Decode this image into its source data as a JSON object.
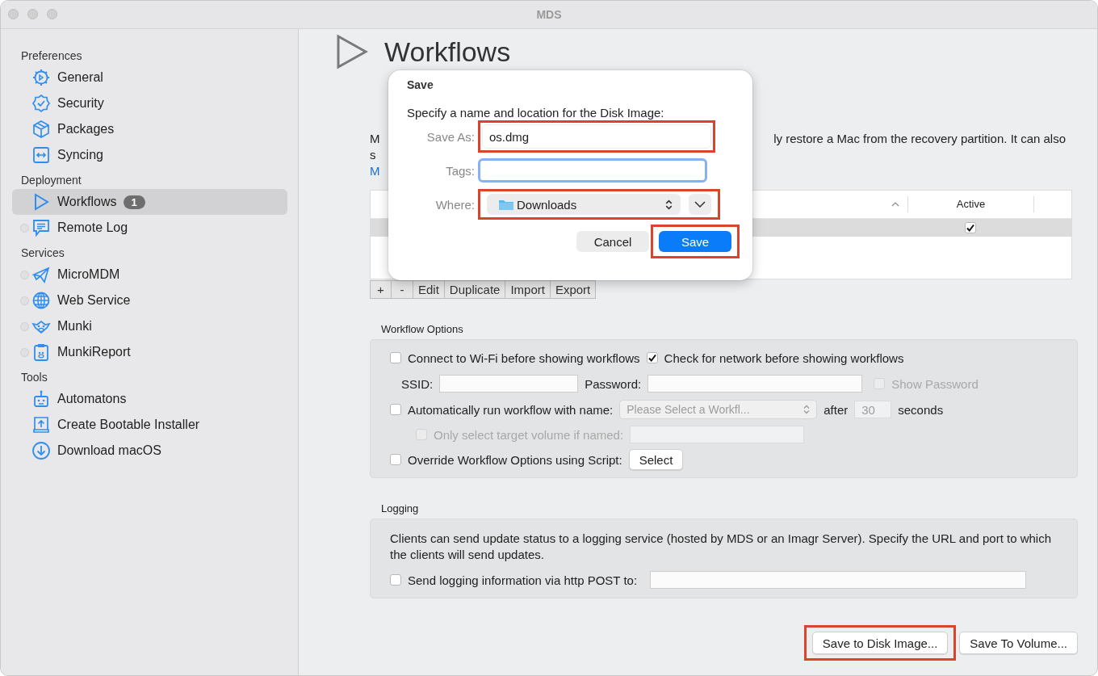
{
  "window": {
    "title": "MDS"
  },
  "sidebar": {
    "sections": [
      {
        "title": "Preferences",
        "items": [
          {
            "label": "General",
            "selected": false,
            "indicator": false
          },
          {
            "label": "Security",
            "selected": false,
            "indicator": false
          },
          {
            "label": "Packages",
            "selected": false,
            "indicator": false
          },
          {
            "label": "Syncing",
            "selected": false,
            "indicator": false
          }
        ]
      },
      {
        "title": "Deployment",
        "items": [
          {
            "label": "Workflows",
            "selected": true,
            "indicator": false,
            "badge": "1"
          },
          {
            "label": "Remote Log",
            "selected": false,
            "indicator": true
          }
        ]
      },
      {
        "title": "Services",
        "items": [
          {
            "label": "MicroMDM",
            "selected": false,
            "indicator": true
          },
          {
            "label": "Web Service",
            "selected": false,
            "indicator": true
          },
          {
            "label": "Munki",
            "selected": false,
            "indicator": true
          },
          {
            "label": "MunkiReport",
            "selected": false,
            "indicator": true
          }
        ]
      },
      {
        "title": "Tools",
        "items": [
          {
            "label": "Automatons",
            "selected": false,
            "indicator": false
          },
          {
            "label": "Create Bootable Installer",
            "selected": false,
            "indicator": false
          },
          {
            "label": "Download macOS",
            "selected": false,
            "indicator": false
          }
        ]
      }
    ]
  },
  "page": {
    "title": "Workflows",
    "description_fragments": [
      "M",
      "ly restore a Mac from the recovery partition. It can also",
      "s"
    ],
    "link_fragment": "M"
  },
  "table": {
    "columns": [
      {
        "label": "Active"
      }
    ],
    "rows": [
      {
        "selected": true,
        "active": true
      }
    ]
  },
  "table_buttons": [
    "+",
    "-",
    "Edit",
    "Duplicate",
    "Import",
    "Export"
  ],
  "workflow_options": {
    "title": "Workflow Options",
    "connect_wifi": {
      "label": "Connect to Wi-Fi before showing workflows",
      "checked": false,
      "disabled": false
    },
    "check_network": {
      "label": "Check for network before showing workflows",
      "checked": true,
      "disabled": false
    },
    "ssid": {
      "label": "SSID:"
    },
    "password": {
      "label": "Password:"
    },
    "show_password": {
      "label": "Show Password",
      "checked": false,
      "disabled": true
    },
    "auto_run": {
      "label": "Automatically run workflow with name:",
      "checked": false,
      "disabled": false
    },
    "workflow_popup": {
      "value": "Please Select a Workfl...",
      "disabled": true
    },
    "after_label": "after",
    "delay": {
      "value": "30",
      "disabled": true
    },
    "seconds_label": "seconds",
    "target_volume": {
      "label": "Only select target volume if named:",
      "checked": false,
      "disabled": true
    },
    "target_volume_field": {
      "disabled": true
    },
    "override": {
      "label": "Override Workflow Options using Script:",
      "checked": false,
      "disabled": false
    },
    "select_button": "Select"
  },
  "logging": {
    "title": "Logging",
    "description": "Clients can send update status to a logging service (hosted by MDS or an Imagr Server). Specify the URL and port to which the clients will send updates.",
    "send": {
      "label": "Send logging information via http POST to:",
      "checked": false,
      "disabled": false
    }
  },
  "footer_buttons": [
    {
      "label": "Save to Disk Image...",
      "highlighted": true
    },
    {
      "label": "Save To Volume...",
      "highlighted": false
    }
  ],
  "dialog": {
    "title": "Save",
    "message": "Specify a name and location for the Disk Image:",
    "save_as": {
      "label": "Save As:",
      "value": "os.dmg",
      "highlighted": true
    },
    "tags": {
      "label": "Tags:",
      "focused": true
    },
    "where": {
      "label": "Where:",
      "value": "Downloads",
      "highlighted": true
    },
    "buttons": [
      {
        "label": "Cancel",
        "default": false,
        "highlighted": false
      },
      {
        "label": "Save",
        "default": true,
        "highlighted": true
      }
    ]
  }
}
